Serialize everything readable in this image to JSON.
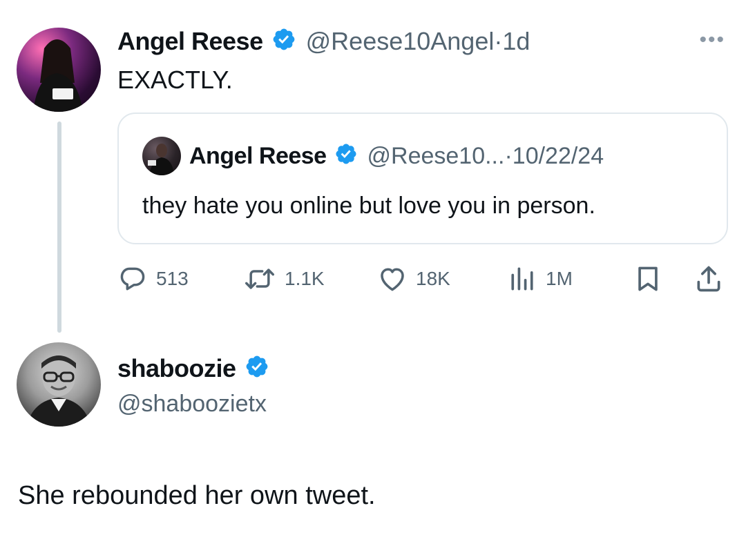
{
  "tweet": {
    "author_name": "Angel Reese",
    "handle": "@Reese10Angel",
    "separator": "·",
    "time": "1d",
    "text": "EXACTLY.",
    "more_icon": "more-horizontal-icon",
    "quote": {
      "author_name": "Angel Reese",
      "handle": "@Reese10...",
      "separator": "·",
      "date": "10/22/24",
      "text": "they hate you online but love you in person."
    },
    "actions": {
      "replies": "513",
      "reposts": "1.1K",
      "likes": "18K",
      "views": "1M"
    }
  },
  "reply": {
    "author_name": "shaboozie",
    "handle": "@shaboozietx",
    "text": "She rebounded her own tweet."
  },
  "colors": {
    "verified_blue": "#1d9bf0",
    "text": "#0f1419",
    "muted": "#536471",
    "border": "#e1e8ed",
    "thread_line": "#cfd9de"
  }
}
